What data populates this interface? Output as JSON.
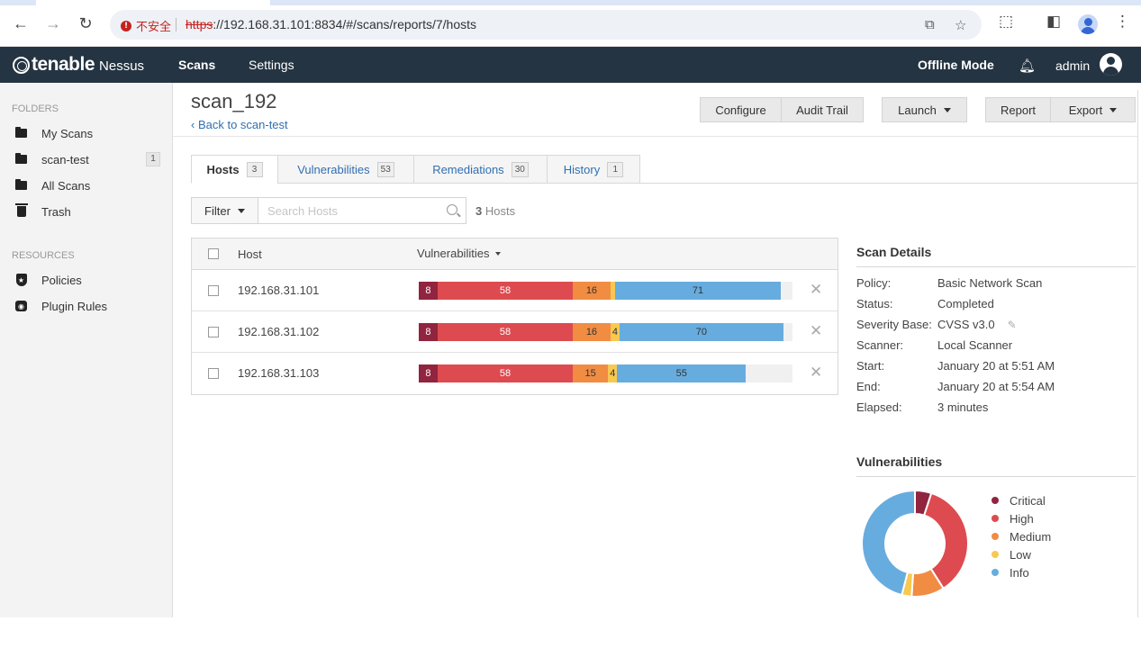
{
  "browser": {
    "security_label": "不安全",
    "url_scheme": "https",
    "url_rest": "://192.168.31.101:8834/#/scans/reports/7/hosts"
  },
  "header": {
    "logo_brand": "tenable",
    "logo_product": "Nessus",
    "nav_scans": "Scans",
    "nav_settings": "Settings",
    "mode": "Offline Mode",
    "user": "admin"
  },
  "sidebar": {
    "folders_heading": "FOLDERS",
    "folders": [
      {
        "label": "My Scans",
        "icon": "folder-icon"
      },
      {
        "label": "scan-test",
        "icon": "folder-icon",
        "count": "1"
      },
      {
        "label": "All Scans",
        "icon": "folder-icon"
      },
      {
        "label": "Trash",
        "icon": "trash-icon"
      }
    ],
    "resources_heading": "RESOURCES",
    "resources": [
      {
        "label": "Policies",
        "icon": "shield-icon"
      },
      {
        "label": "Plugin Rules",
        "icon": "plugin-icon"
      }
    ]
  },
  "page": {
    "title": "scan_192",
    "back": "‹ Back to scan-test",
    "buttons": {
      "configure": "Configure",
      "audit_trail": "Audit Trail",
      "launch": "Launch",
      "report": "Report",
      "export": "Export"
    }
  },
  "tabs": [
    {
      "label": "Hosts",
      "count": "3"
    },
    {
      "label": "Vulnerabilities",
      "count": "53"
    },
    {
      "label": "Remediations",
      "count": "30"
    },
    {
      "label": "History",
      "count": "1"
    }
  ],
  "filter": {
    "label": "Filter",
    "search_placeholder": "Search Hosts",
    "host_count": "3",
    "host_count_suffix": " Hosts"
  },
  "hosts_table": {
    "col_host": "Host",
    "col_vulns": "Vulnerabilities",
    "rows": [
      {
        "host": "192.168.31.101",
        "critical": 8,
        "high": 58,
        "medium": 16,
        "low": 2,
        "info": 71,
        "labels": [
          "8",
          "58",
          "16",
          "",
          "71"
        ]
      },
      {
        "host": "192.168.31.102",
        "critical": 8,
        "high": 58,
        "medium": 16,
        "low": 4,
        "info": 70,
        "labels": [
          "8",
          "58",
          "16",
          "4",
          "70"
        ]
      },
      {
        "host": "192.168.31.103",
        "critical": 8,
        "high": 58,
        "medium": 15,
        "low": 4,
        "info": 55,
        "labels": [
          "8",
          "58",
          "15",
          "4",
          "55"
        ]
      }
    ],
    "bar_max_total": 160
  },
  "scan_details": {
    "heading": "Scan Details",
    "items": [
      {
        "k": "Policy:",
        "v": "Basic Network Scan"
      },
      {
        "k": "Status:",
        "v": "Completed"
      },
      {
        "k": "Severity Base:",
        "v": "CVSS v3.0"
      },
      {
        "k": "Scanner:",
        "v": "Local Scanner"
      },
      {
        "k": "Start:",
        "v": "January 20 at 5:51 AM"
      },
      {
        "k": "End:",
        "v": "January 20 at 5:54 AM"
      },
      {
        "k": "Elapsed:",
        "v": "3 minutes"
      }
    ]
  },
  "vuln_summary": {
    "heading": "Vulnerabilities",
    "legend": [
      "Critical",
      "High",
      "Medium",
      "Low",
      "Info"
    ],
    "colors": {
      "critical": "#91243e",
      "high": "#dd4b50",
      "medium": "#f18c43",
      "low": "#f8c851",
      "info": "#67acdf"
    },
    "chart_data": {
      "type": "pie",
      "categories": [
        "Critical",
        "High",
        "Medium",
        "Low",
        "Info"
      ],
      "values": [
        5,
        36,
        10,
        3,
        46
      ]
    }
  }
}
